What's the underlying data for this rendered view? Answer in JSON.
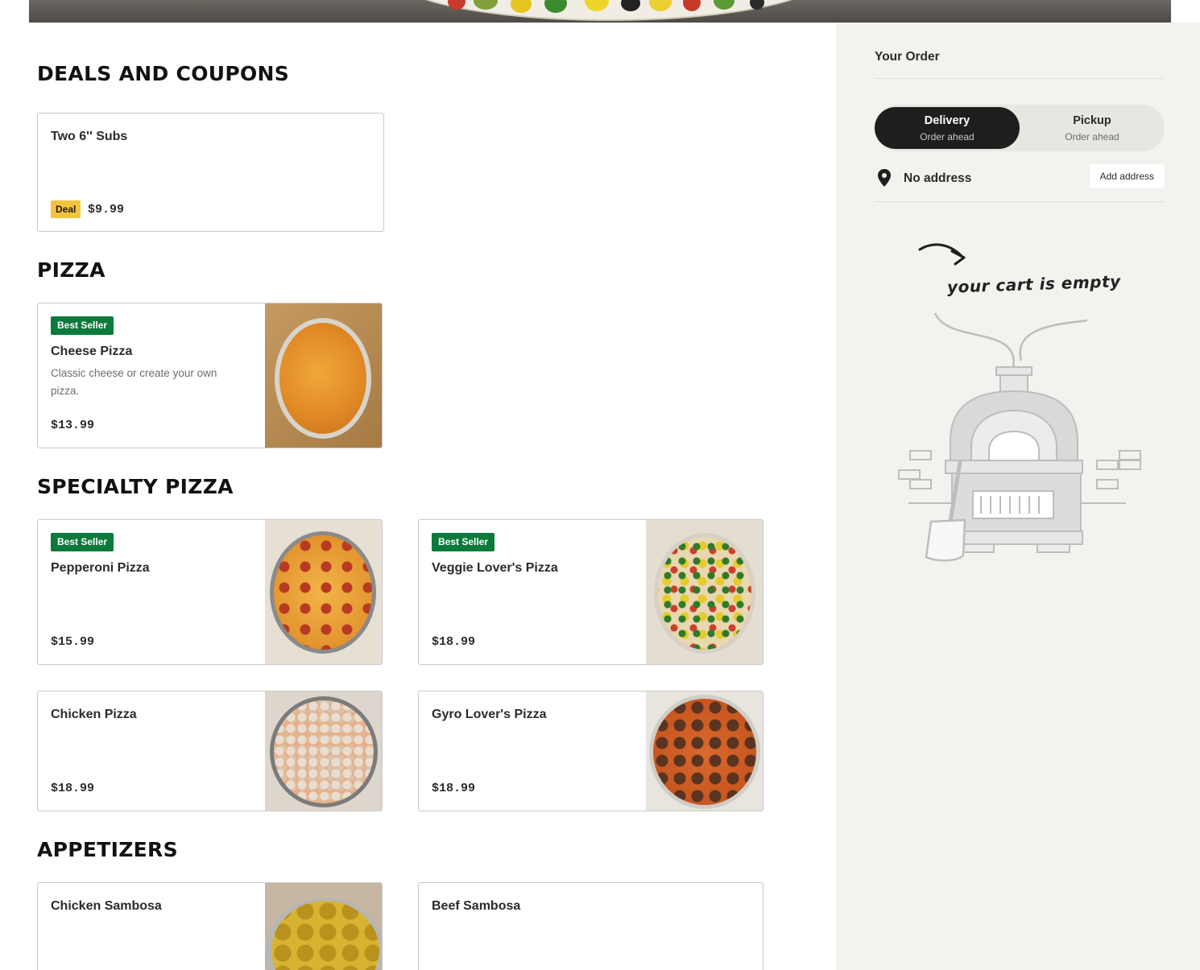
{
  "colors": {
    "accent_dark": "#1e1e1e",
    "best_seller": "#0b7a3b",
    "deal": "#f5c23e",
    "sidebar_bg": "#f3f2ef"
  },
  "menu": {
    "sections": [
      {
        "title": "DEALS AND COUPONS",
        "items": [
          {
            "name": "Two 6'' Subs",
            "badge": "Deal",
            "price": "$9.99"
          }
        ]
      },
      {
        "title": "PIZZA",
        "items": [
          {
            "name": "Cheese Pizza",
            "badge": "Best Seller",
            "description": "Classic cheese or create your own pizza.",
            "price": "$13.99",
            "image_icon": "cheese-pizza-photo"
          }
        ]
      },
      {
        "title": "SPECIALTY PIZZA",
        "items": [
          {
            "name": "Pepperoni Pizza",
            "badge": "Best Seller",
            "price": "$15.99",
            "image_icon": "pepperoni-pizza-photo"
          },
          {
            "name": "Veggie Lover's Pizza",
            "badge": "Best Seller",
            "price": "$18.99",
            "image_icon": "veggie-pizza-photo"
          },
          {
            "name": "Chicken Pizza",
            "price": "$18.99",
            "image_icon": "chicken-pizza-photo"
          },
          {
            "name": "Gyro Lover's Pizza",
            "price": "$18.99",
            "image_icon": "gyro-pizza-photo"
          }
        ]
      },
      {
        "title": "APPETIZERS",
        "items": [
          {
            "name": "Chicken Sambosa",
            "image_icon": "sambosa-photo"
          },
          {
            "name": "Beef Sambosa"
          }
        ]
      }
    ]
  },
  "order": {
    "heading": "Your Order",
    "modes": [
      {
        "label": "Delivery",
        "sub": "Order ahead",
        "selected": true
      },
      {
        "label": "Pickup",
        "sub": "Order ahead",
        "selected": false
      }
    ],
    "address": {
      "icon": "location-pin-icon",
      "label": "No address",
      "button": "Add address"
    },
    "empty_message": "your cart is empty",
    "empty_art_icon": "pizza-oven-illustration"
  }
}
